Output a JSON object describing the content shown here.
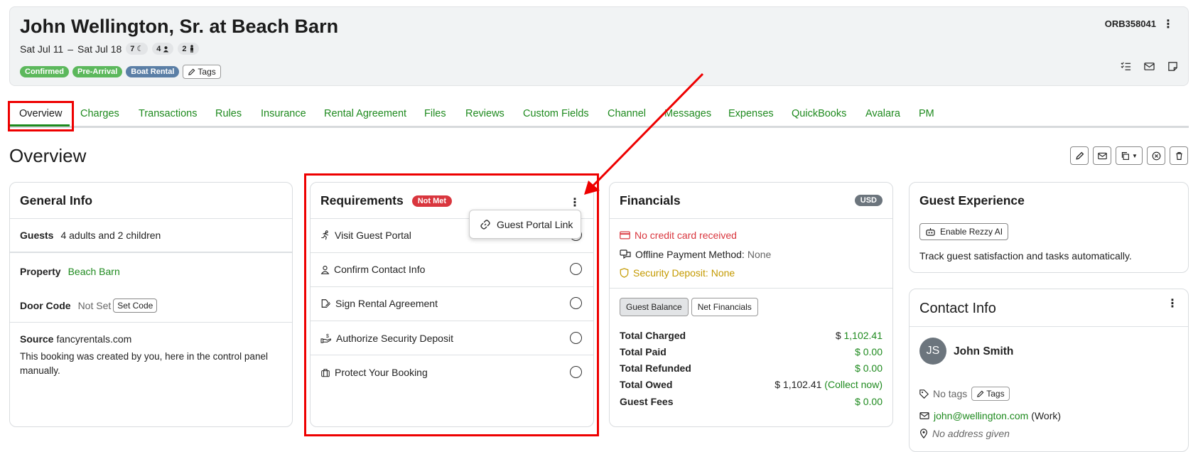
{
  "header": {
    "title": "John Wellington, Sr. at Beach Barn",
    "date_start": "Sat Jul 11",
    "date_sep": "–",
    "date_end": "Sat Jul 18",
    "nights": "7",
    "adults": "4",
    "children": "2",
    "badges": [
      "Confirmed",
      "Pre-Arrival",
      "Boat Rental"
    ],
    "tags_label": "Tags",
    "reference": "ORB358041",
    "kebab": "⋮"
  },
  "tabs": [
    "Overview",
    "Charges",
    "Transactions",
    "Rules",
    "Insurance",
    "Rental Agreement",
    "Files",
    "Reviews",
    "Custom Fields",
    "Channel",
    "Messages",
    "Expenses",
    "QuickBooks",
    "Avalara",
    "PM"
  ],
  "overview_title": "Overview",
  "general_info": {
    "title": "General Info",
    "guests_label": "Guests",
    "guests_value": "4 adults and 2 children",
    "property_label": "Property",
    "property_value": "Beach Barn",
    "door_code_label": "Door Code",
    "door_code_value": "Not Set",
    "set_code_label": "Set Code",
    "source_label": "Source",
    "source_value": "fancyrentals.com",
    "source_note": "This booking was created by you, here in the control panel manually."
  },
  "requirements": {
    "title": "Requirements",
    "status": "Not Met",
    "popover_label": "Guest Portal Link",
    "items": [
      "Visit Guest Portal",
      "Confirm Contact Info",
      "Sign Rental Agreement",
      "Authorize Security Deposit",
      "Protect Your Booking"
    ]
  },
  "financials": {
    "title": "Financials",
    "currency": "USD",
    "no_card": "No credit card received",
    "offline_label": "Offline Payment Method:",
    "offline_value": "None",
    "deposit": "Security Deposit: None",
    "toggle_guest": "Guest Balance",
    "toggle_net": "Net Financials",
    "rows": [
      {
        "label": "Total Charged",
        "currency": "$",
        "value": "1,102.41"
      },
      {
        "label": "Total Paid",
        "currency": "$",
        "value": "0.00"
      },
      {
        "label": "Total Refunded",
        "currency": "$",
        "value": "0.00"
      },
      {
        "label": "Total Owed",
        "currency": "$",
        "value": "1,102.41",
        "extra": "(Collect now)"
      },
      {
        "label": "Guest Fees",
        "currency": "$",
        "value": "0.00"
      }
    ]
  },
  "guest_experience": {
    "title": "Guest Experience",
    "button": "Enable Rezzy AI",
    "text": "Track guest satisfaction and tasks automatically."
  },
  "contact_info": {
    "title": "Contact Info",
    "initials": "JS",
    "name": "John Smith",
    "no_tags": "No tags",
    "tags_label": "Tags",
    "email": "john@wellington.com",
    "email_type": "(Work)",
    "address": "No address given"
  },
  "colors": {
    "accent_green": "#1e8a1e",
    "danger_red": "#d9363e",
    "annotation_red": "#e00000"
  }
}
